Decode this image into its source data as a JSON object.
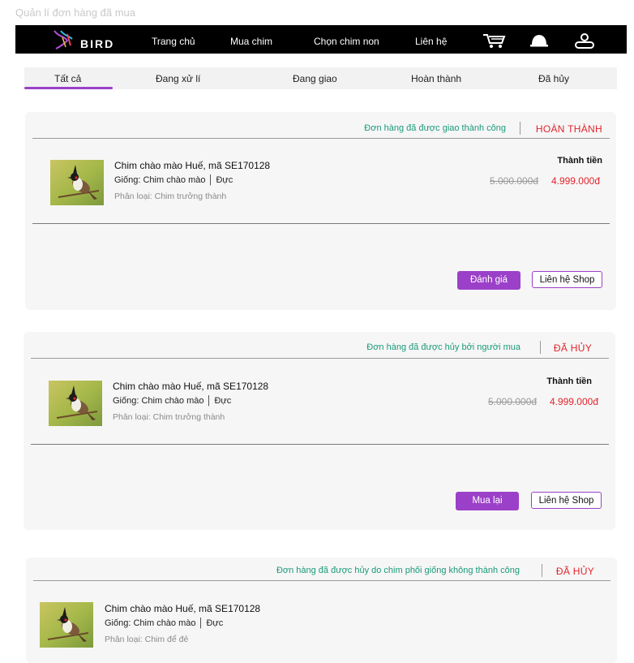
{
  "page_label": "Quản lí đơn hàng đã mua",
  "navbar": {
    "logo_text": "BIRD",
    "items": [
      "Trang chủ",
      "Mua chim",
      "Chọn chim non",
      "Liên hệ"
    ],
    "icons": [
      "cart-icon",
      "notification-bell-icon",
      "user-profile-icon"
    ]
  },
  "tabs": [
    "Tất cả",
    "Đang xử lí",
    "Đang giao",
    "Hoàn thành",
    "Đã hủy"
  ],
  "active_tab": "Tất cả",
  "orders": [
    {
      "status_message": "Đơn hàng đã được giao thành công",
      "status_label": "HOÀN THÀNH",
      "product_name": "Chim chào mào Huế, mã SE170128",
      "breed": "Giống: Chim chào mào │ Đực",
      "category": "Phân loại: Chim trưởng thành",
      "total_label": "Thành tiền",
      "old_price": "5.000.000đ",
      "new_price": "4.999.000đ",
      "primary_button": "Đánh giá",
      "secondary_button": "Liên hệ Shop"
    },
    {
      "status_message": "Đơn hàng đã được hủy bởi người mua",
      "status_label": "ĐÃ HỦY",
      "product_name": "Chim chào mào Huế, mã SE170128",
      "breed": "Giống: Chim chào mào │ Đực",
      "category": "Phân loại: Chim trưởng thành",
      "total_label": "Thành tiền",
      "old_price": "5.000.000đ",
      "new_price": "4.999.000đ",
      "primary_button": "Mua lại",
      "secondary_button": "Liên hệ Shop"
    },
    {
      "status_message": "Đơn hàng đã được hủy do chim phối giống không thành công",
      "status_label": "ĐÃ HỦY",
      "product_name": "Chim chào mào Huế, mã SE170128",
      "breed": "Giống: Chim chào mào │ Đực",
      "category": "Phân loại: Chim để đẻ"
    }
  ],
  "colors": {
    "accent": "#9b40c8",
    "success_text": "#1a9a79",
    "status_red": "#e3242b",
    "navbar_bg": "#000000"
  }
}
